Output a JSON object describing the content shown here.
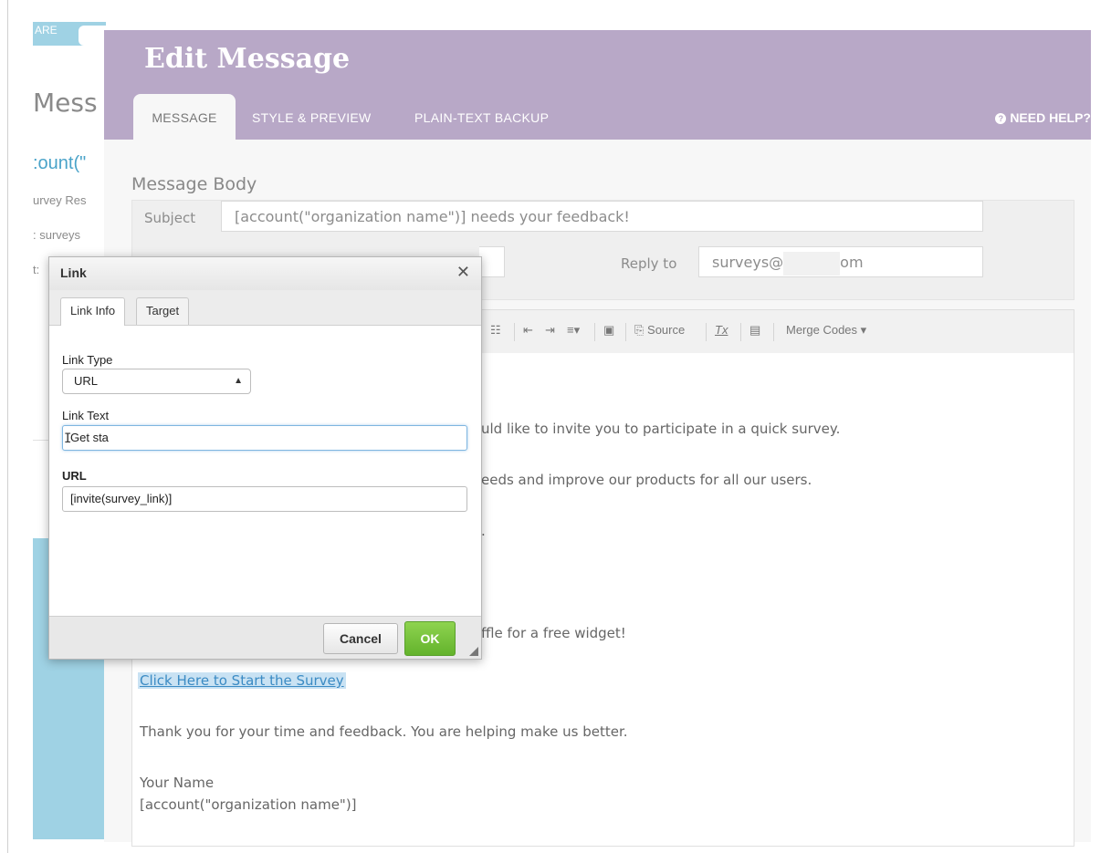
{
  "background_page": {
    "tab_fragment": "ARE",
    "title_fragment": "Mess",
    "code_fragment": ":ount(\"",
    "line1_fragment": "urvey Res",
    "line2_fragment": ": surveys",
    "line3_fragment": "t:"
  },
  "editor": {
    "title": "Edit Message",
    "tabs": [
      {
        "label": "MESSAGE",
        "active": true
      },
      {
        "label": "STYLE & PREVIEW",
        "active": false
      },
      {
        "label": "PLAIN-TEXT BACKUP",
        "active": false
      }
    ],
    "help_icon": "?",
    "help_label": "NEED HELP?",
    "section_title": "Message Body",
    "subject_label": "Subject",
    "subject_value": "[account(\"organization name\")] needs your feedback!",
    "reply_to_label": "Reply to",
    "reply_to_value_start": "surveys@",
    "reply_to_value_end": "om",
    "toolbar": {
      "source_label": "Source",
      "clear_format_label": "Tx",
      "merge_codes_label": "Merge Codes"
    },
    "body": {
      "line1": "uld like to invite you to participate in a quick survey.",
      "line2": "eeds and improve our products for all our users.",
      "line3": ".",
      "line4": "ffle for a free widget!",
      "link": "Click Here to Start the Survey",
      "thanks": "Thank you for your time and feedback. You are helping make us better.",
      "signature_name": "Your Name",
      "signature_org": "[account(\"organization name\")]"
    }
  },
  "dialog": {
    "title": "Link",
    "close_glyph": "✕",
    "tabs": [
      "Link Info",
      "Target"
    ],
    "link_type_label": "Link Type",
    "link_type_value": "URL",
    "link_text_label": "Link Text",
    "link_text_value": "Get sta",
    "url_label": "URL",
    "url_value": "[invite(survey_link)]",
    "cancel_label": "Cancel",
    "ok_label": "OK"
  },
  "colors": {
    "header_purple": "#b8a8c7",
    "ok_green": "#63b32c",
    "link_blue": "#3b8bc4",
    "side_blue": "#9fd2e4"
  }
}
